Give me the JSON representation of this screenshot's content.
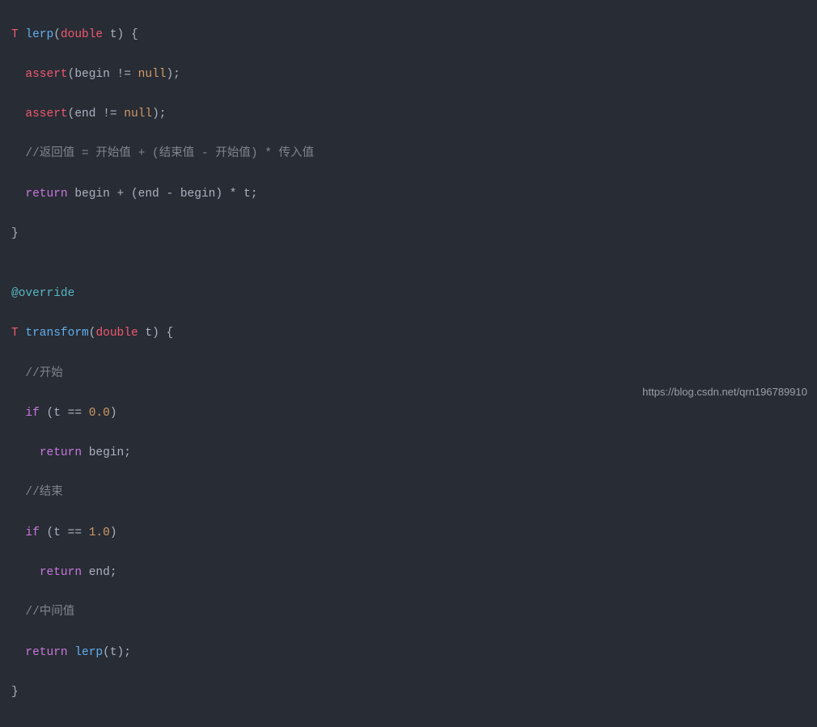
{
  "code": {
    "l1": {
      "type": "T",
      "func": "lerp",
      "ptype": "double",
      "pname": "t"
    },
    "l2": {
      "kw": "assert",
      "expr_left": "begin",
      "op": "!=",
      "null": "null"
    },
    "l3": {
      "kw": "assert",
      "expr_left": "end",
      "op": "!=",
      "null": "null"
    },
    "l4": {
      "comment": "//返回值 = 开始值 + (结束值 - 开始值) * 传入值"
    },
    "l5": {
      "kw": "return",
      "expr": "begin + (end - begin) * t;"
    },
    "l6": {
      "brace": "}"
    },
    "l7": {
      "blank": ""
    },
    "l8": {
      "annot": "@override"
    },
    "l9": {
      "type": "T",
      "func": "transform",
      "ptype": "double",
      "pname": "t"
    },
    "l10": {
      "comment": "//开始"
    },
    "l11": {
      "kw": "if",
      "cond_var": "t",
      "cond_op": "==",
      "cond_val": "0.0"
    },
    "l12": {
      "kw": "return",
      "val": "begin"
    },
    "l13": {
      "comment": "//结束"
    },
    "l14": {
      "kw": "if",
      "cond_var": "t",
      "cond_op": "==",
      "cond_val": "1.0"
    },
    "l15": {
      "kw": "return",
      "val": "end"
    },
    "l16": {
      "comment": "//中间值"
    },
    "l17": {
      "kw": "return",
      "func": "lerp",
      "arg": "t"
    },
    "l18": {
      "brace": "}"
    }
  },
  "watermark": "https://blog.csdn.net/qrn196789910"
}
